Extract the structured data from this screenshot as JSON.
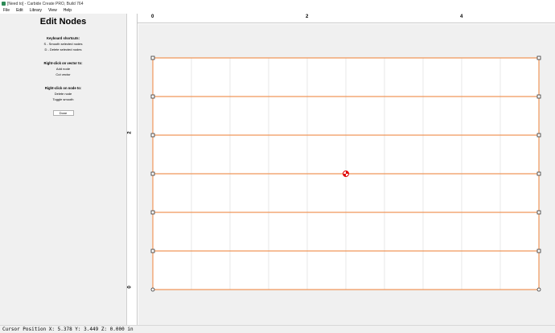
{
  "window": {
    "title": "[Need to] - Carbide Create PRO, Build 764"
  },
  "menu": {
    "items": [
      "File",
      "Edit",
      "Library",
      "View",
      "Help"
    ]
  },
  "panel": {
    "title": "Edit Nodes",
    "sections": [
      {
        "heading": "Keyboard shortcuts:",
        "lines": [
          "S - Smooth selected nodes",
          "D - Delete selected nodes"
        ]
      },
      {
        "heading": "Right-click on vector to:",
        "lines": [
          "Add node",
          "Cut vector"
        ]
      },
      {
        "heading": "Right-click on node to:",
        "lines": [
          "Delete node",
          "Toggle smooth"
        ]
      }
    ],
    "done_label": "Done"
  },
  "ruler": {
    "x_labels": [
      "0",
      "2",
      "4"
    ],
    "y_labels": [
      "2",
      "0"
    ]
  },
  "status": {
    "text": "Cursor Position X: 5.378 Y: 3.449 Z: 0.000 in"
  },
  "colors": {
    "vector": "#f0965a",
    "node_fill": "#ffffff",
    "node_stroke": "#333333",
    "grid": "#d8d8d8",
    "origin_marker": "#e00000"
  }
}
